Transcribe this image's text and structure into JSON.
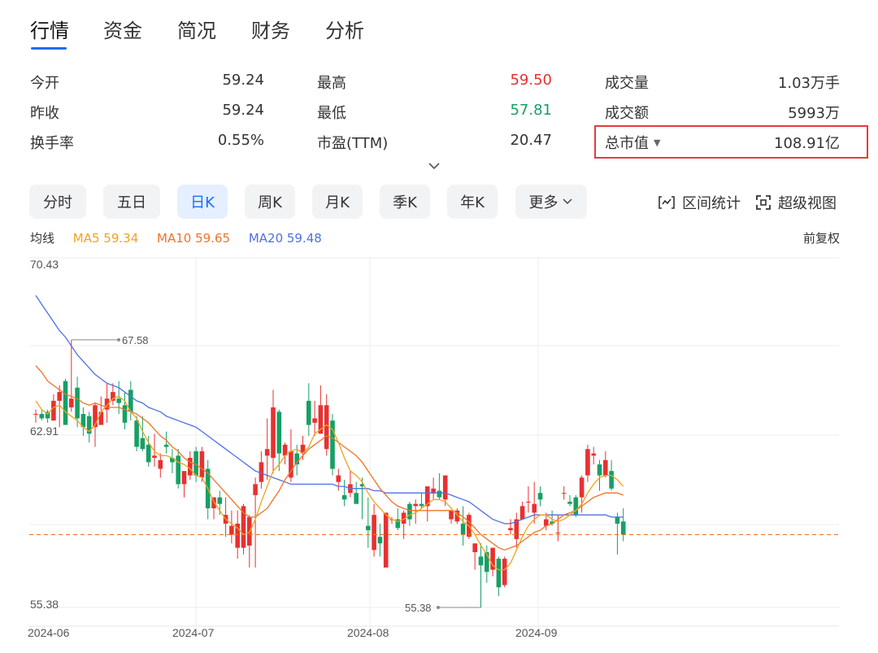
{
  "tabs": [
    "行情",
    "资金",
    "简况",
    "财务",
    "分析"
  ],
  "stats": {
    "open": {
      "label": "今开",
      "value": "59.24"
    },
    "prev_close": {
      "label": "昨收",
      "value": "59.24"
    },
    "turnover": {
      "label": "换手率",
      "value": "0.55%"
    },
    "high": {
      "label": "最高",
      "value": "59.50"
    },
    "low": {
      "label": "最低",
      "value": "57.81"
    },
    "pe": {
      "label": "市盈(TTM)",
      "value": "20.47"
    },
    "volume": {
      "label": "成交量",
      "value": "1.03万手"
    },
    "amount": {
      "label": "成交额",
      "value": "5993万"
    },
    "market_cap": {
      "label": "总市值",
      "value": "108.91亿"
    }
  },
  "periods": [
    "分时",
    "五日",
    "日K",
    "周K",
    "月K",
    "季K",
    "年K",
    "更多"
  ],
  "active_period": "日K",
  "tools": {
    "range_stat": "区间统计",
    "super_view": "超级视图"
  },
  "ma": {
    "title": "均线",
    "ma5": "MA5 59.34",
    "ma10": "MA10 59.65",
    "ma20": "MA20 59.48"
  },
  "adjust": "前复权",
  "colors": {
    "up": "#e93030",
    "down": "#16a064",
    "ma5": "#f2a31c",
    "ma10": "#f07326",
    "ma20": "#4f6fe4",
    "accent": "#1a6ef5",
    "last_price_line": "#f07326",
    "highlight_box": "#e83a3a"
  },
  "chart_data": {
    "type": "candlestick",
    "y_tick_labels": [
      "70.43",
      "62.91",
      "55.38"
    ],
    "ylim": [
      55.38,
      70.43
    ],
    "x_tick_labels": [
      "2024-06",
      "2024-07",
      "2024-08",
      "2024-09"
    ],
    "max_annotation": "67.58",
    "min_annotation": "55.38",
    "candles": [
      [
        64.2,
        64.4,
        63.8,
        64.2
      ],
      [
        64.2,
        64.4,
        63.9,
        64.0
      ],
      [
        64.3,
        64.4,
        63.8,
        64.0
      ],
      [
        63.9,
        65.1,
        63.9,
        64.8
      ],
      [
        64.8,
        65.5,
        63.6,
        65.2
      ],
      [
        65.7,
        65.8,
        63.7,
        63.7
      ],
      [
        64.5,
        67.58,
        64.3,
        64.9
      ],
      [
        65.4,
        65.9,
        63.6,
        64.0
      ],
      [
        64.2,
        64.5,
        63.2,
        63.6
      ],
      [
        64.1,
        64.3,
        62.9,
        63.3
      ],
      [
        63.6,
        64.7,
        62.7,
        64.6
      ],
      [
        63.7,
        65.0,
        63.7,
        64.3
      ],
      [
        64.4,
        65.6,
        63.8,
        64.9
      ],
      [
        64.8,
        65.6,
        64.6,
        65.2
      ],
      [
        64.9,
        65.7,
        64.2,
        64.7
      ],
      [
        64.6,
        65.2,
        63.5,
        63.8
      ],
      [
        65.3,
        65.7,
        63.9,
        64.3
      ],
      [
        63.9,
        64.1,
        62.5,
        62.7
      ],
      [
        63.1,
        64.1,
        62.5,
        62.6
      ],
      [
        62.8,
        63.2,
        61.8,
        62.0
      ],
      [
        62.2,
        63.3,
        61.8,
        62.3
      ],
      [
        61.7,
        62.4,
        61.3,
        62.1
      ],
      [
        62.8,
        63.4,
        62.4,
        62.7
      ],
      [
        62.2,
        62.6,
        61.5,
        62.0
      ],
      [
        62.3,
        62.6,
        60.8,
        61.0
      ],
      [
        61.0,
        61.3,
        60.4,
        61.6
      ],
      [
        61.4,
        62.5,
        61.2,
        62.2
      ],
      [
        62.5,
        62.7,
        61.1,
        61.4
      ],
      [
        61.3,
        62.7,
        61.1,
        62.5
      ],
      [
        61.7,
        62.1,
        59.4,
        59.9
      ],
      [
        59.9,
        60.4,
        59.4,
        60.4
      ],
      [
        60.4,
        60.7,
        59.6,
        60.1
      ],
      [
        59.2,
        60.4,
        58.6,
        59.6
      ],
      [
        58.7,
        59.8,
        58.3,
        59.1
      ],
      [
        58.1,
        59.8,
        57.6,
        59.2
      ],
      [
        58.1,
        60.1,
        57.8,
        60.0
      ],
      [
        58.2,
        59.6,
        57.2,
        59.5
      ],
      [
        60.5,
        61.3,
        57.2,
        61.0
      ],
      [
        61.1,
        62.5,
        60.8,
        62.0
      ],
      [
        62.3,
        64.0,
        61.2,
        62.6
      ],
      [
        62.2,
        65.3,
        61.5,
        64.5
      ],
      [
        64.3,
        64.4,
        61.6,
        62.4
      ],
      [
        62.3,
        62.9,
        61.9,
        62.8
      ],
      [
        61.3,
        63.5,
        61.1,
        62.5
      ],
      [
        62.4,
        62.8,
        61.4,
        61.9
      ],
      [
        62.4,
        63.2,
        62.1,
        62.8
      ],
      [
        64.8,
        65.6,
        63.2,
        63.7
      ],
      [
        63.8,
        64.8,
        63.2,
        64.0
      ],
      [
        63.3,
        65.5,
        63.3,
        64.6
      ],
      [
        62.6,
        65.1,
        62.3,
        64.6
      ],
      [
        63.9,
        64.2,
        61.4,
        61.7
      ],
      [
        61.1,
        61.7,
        60.7,
        61.4
      ],
      [
        60.5,
        61.2,
        60.0,
        60.3
      ],
      [
        60.6,
        61.6,
        60.4,
        61.0
      ],
      [
        60.6,
        61.1,
        60.1,
        60.1
      ],
      [
        61.0,
        61.3,
        59.4,
        60.9
      ],
      [
        59.1,
        60.4,
        58.1,
        58.9
      ],
      [
        58.0,
        60.1,
        57.7,
        59.6
      ],
      [
        58.6,
        59.2,
        57.7,
        58.3
      ],
      [
        57.2,
        58.9,
        57.2,
        59.7
      ],
      [
        59.4,
        59.5,
        59.2,
        59.4
      ],
      [
        59.4,
        59.9,
        58.9,
        59.0
      ],
      [
        59.2,
        59.8,
        58.5,
        59.7
      ],
      [
        60.1,
        60.2,
        59.1,
        59.4
      ],
      [
        60.0,
        60.3,
        59.2,
        60.1
      ],
      [
        60.1,
        60.6,
        59.9,
        60.0
      ],
      [
        60.0,
        60.8,
        59.3,
        60.9
      ],
      [
        60.6,
        61.3,
        60.3,
        60.8
      ],
      [
        60.7,
        61.5,
        60.3,
        60.4
      ],
      [
        60.3,
        61.0,
        60.0,
        61.4
      ],
      [
        59.4,
        59.8,
        59.2,
        59.8
      ],
      [
        59.3,
        59.9,
        59.2,
        59.8
      ],
      [
        59.2,
        60.0,
        58.2,
        58.7
      ],
      [
        58.6,
        59.7,
        58.5,
        59.6
      ],
      [
        57.9,
        58.3,
        57.1,
        58.3
      ],
      [
        57.7,
        58.3,
        55.38,
        57.3
      ],
      [
        57.9,
        58.2,
        56.5,
        57.0
      ],
      [
        57.1,
        57.9,
        56.8,
        58.1
      ],
      [
        57.6,
        57.7,
        55.9,
        56.3
      ],
      [
        56.4,
        57.7,
        56.3,
        57.6
      ],
      [
        58.9,
        59.4,
        58.7,
        59.0
      ],
      [
        58.5,
        59.7,
        58.1,
        59.4
      ],
      [
        59.4,
        60.2,
        59.4,
        60.0
      ],
      [
        60.2,
        60.9,
        59.7,
        60.2
      ],
      [
        59.7,
        61.1,
        59.2,
        60.1
      ],
      [
        60.6,
        60.9,
        60.0,
        60.3
      ],
      [
        59.1,
        59.7,
        58.9,
        59.4
      ],
      [
        59.3,
        59.8,
        59.1,
        59.2
      ],
      [
        58.8,
        59.6,
        58.4,
        58.8
      ],
      [
        60.6,
        60.9,
        60.3,
        60.6
      ],
      [
        60.2,
        60.5,
        60.0,
        60.1
      ],
      [
        60.4,
        60.5,
        59.5,
        59.6
      ],
      [
        60.4,
        61.4,
        59.7,
        61.3
      ],
      [
        61.4,
        62.8,
        61.1,
        62.6
      ],
      [
        62.3,
        62.7,
        61.9,
        62.4
      ],
      [
        61.9,
        62.1,
        60.7,
        61.4
      ],
      [
        61.4,
        62.5,
        61.3,
        62.1
      ],
      [
        61.6,
        62.1,
        60.7,
        60.8
      ],
      [
        59.5,
        59.7,
        57.8,
        59.2
      ],
      [
        59.3,
        59.9,
        58.4,
        58.7
      ]
    ],
    "ma5": [
      64.8,
      64.4,
      64.2,
      64.5,
      64.6,
      64.3,
      64.1,
      63.9,
      63.6,
      63.4,
      63.7,
      64.3,
      64.6,
      64.9,
      65.0,
      64.8,
      64.3,
      64.0,
      63.4,
      62.9,
      62.5,
      62.3,
      62.3,
      62.2,
      62.0,
      61.9,
      61.7,
      61.4,
      61.3,
      60.8,
      60.2,
      59.8,
      59.4,
      59.2,
      59.0,
      58.7,
      58.8,
      59.4,
      60.2,
      60.9,
      61.6,
      61.9,
      62.3,
      62.5,
      62.6,
      62.4,
      62.7,
      63.3,
      63.5,
      63.7,
      63.5,
      62.9,
      62.2,
      61.6,
      61.4,
      61.1,
      60.6,
      60.2,
      59.9,
      59.6,
      59.4,
      59.3,
      59.4,
      59.6,
      59.7,
      59.9,
      60.1,
      60.3,
      60.3,
      60.2,
      59.9,
      59.6,
      59.3,
      59.1,
      58.7,
      58.2,
      57.8,
      57.3,
      57.1,
      57.1,
      57.4,
      58.0,
      58.6,
      59.1,
      59.4,
      59.6,
      59.6,
      59.4,
      59.3,
      59.4,
      59.6,
      59.8,
      60.1,
      60.6,
      61.0,
      61.3,
      61.4,
      61.4,
      61.2,
      60.9
    ],
    "ma10": [
      66.4,
      66.1,
      65.7,
      65.5,
      65.3,
      65.1,
      65.0,
      64.9,
      64.7,
      64.6,
      64.7,
      64.6,
      64.5,
      64.5,
      64.5,
      64.4,
      64.3,
      64.2,
      64.0,
      63.8,
      63.5,
      63.2,
      63.0,
      62.7,
      62.5,
      62.2,
      62.0,
      61.9,
      61.7,
      61.5,
      61.2,
      60.9,
      60.6,
      60.3,
      60.0,
      59.7,
      59.5,
      59.5,
      59.7,
      59.9,
      60.3,
      60.7,
      61.2,
      61.6,
      62.0,
      62.3,
      62.6,
      62.8,
      63.0,
      63.2,
      63.1,
      62.9,
      62.7,
      62.5,
      62.3,
      62.0,
      61.6,
      61.2,
      60.8,
      60.5,
      60.2,
      60.0,
      59.9,
      59.8,
      59.8,
      59.8,
      59.8,
      59.8,
      59.8,
      59.8,
      59.8,
      59.7,
      59.5,
      59.3,
      59.0,
      58.7,
      58.5,
      58.3,
      58.1,
      58.0,
      58.1,
      58.2,
      58.4,
      58.6,
      58.8,
      58.9,
      59.1,
      59.2,
      59.4,
      59.6,
      59.7,
      59.8,
      60.0,
      60.2,
      60.4,
      60.5,
      60.6,
      60.6,
      60.6,
      60.5
    ],
    "ma20": [
      69.6,
      69.2,
      68.8,
      68.4,
      68.0,
      67.7,
      67.3,
      66.9,
      66.6,
      66.3,
      66.0,
      65.8,
      65.6,
      65.5,
      65.4,
      65.2,
      65.0,
      64.8,
      64.7,
      64.5,
      64.4,
      64.3,
      64.1,
      64.0,
      63.9,
      63.8,
      63.7,
      63.6,
      63.4,
      63.2,
      63.0,
      62.8,
      62.6,
      62.4,
      62.2,
      62.0,
      61.8,
      61.6,
      61.5,
      61.4,
      61.3,
      61.2,
      61.1,
      61.0,
      61.0,
      61.0,
      61.0,
      61.0,
      61.0,
      61.0,
      61.0,
      60.9,
      60.9,
      60.8,
      60.8,
      60.8,
      60.8,
      60.7,
      60.7,
      60.6,
      60.6,
      60.6,
      60.6,
      60.6,
      60.6,
      60.6,
      60.6,
      60.6,
      60.6,
      60.6,
      60.5,
      60.4,
      60.3,
      60.2,
      60.0,
      59.8,
      59.6,
      59.4,
      59.3,
      59.2,
      59.2,
      59.3,
      59.4,
      59.5,
      59.6,
      59.6,
      59.6,
      59.6,
      59.6,
      59.6,
      59.6,
      59.6,
      59.6,
      59.6,
      59.6,
      59.6,
      59.6,
      59.5,
      59.5,
      59.5
    ],
    "last_price": 58.7
  }
}
